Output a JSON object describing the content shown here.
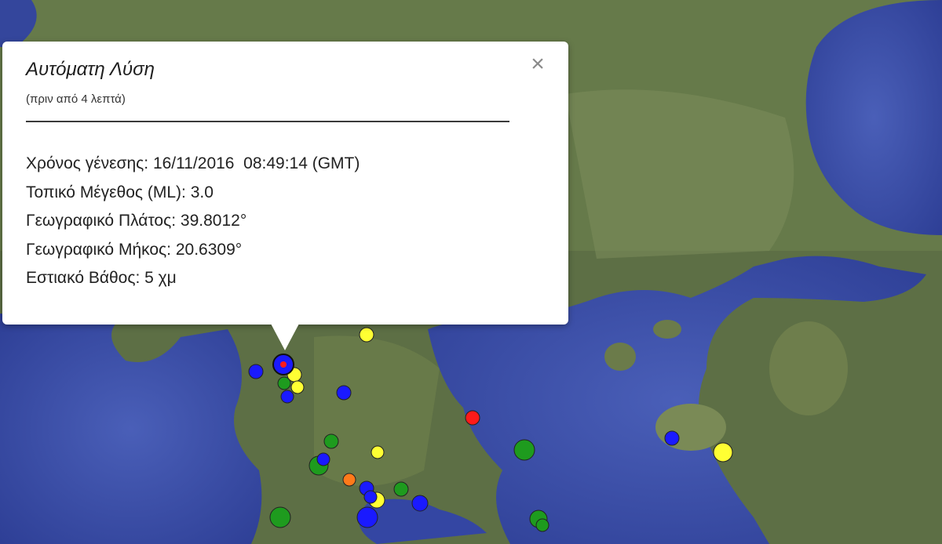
{
  "popup": {
    "title": "Αυτόματη Λύση",
    "subtitle": "(πριν από 4 λεπτά)",
    "close_icon": "close-icon",
    "lines": [
      {
        "label": "Χρόνος γένεσης:",
        "value": "16/11/2016  08:49:14 (GMT)"
      },
      {
        "label": "Τοπικό Μέγεθος (ML):",
        "value": "3.0"
      },
      {
        "label": "Γεωγραφικό Πλάτος:",
        "value": "39.8012°"
      },
      {
        "label": "Γεωγραφικό Μήκος:",
        "value": "20.6309°"
      },
      {
        "label": "Εστιακό Βάθος:",
        "value": "5 χμ"
      }
    ]
  },
  "marker_colors": {
    "blue": "#1a1aff",
    "yellow": "#ffff33",
    "green": "#1e9b1e",
    "red": "#ff1a1a",
    "orange": "#ff7a1a"
  },
  "selected_marker": {
    "latitude": 39.8012,
    "longitude": 20.6309,
    "color": "red"
  }
}
